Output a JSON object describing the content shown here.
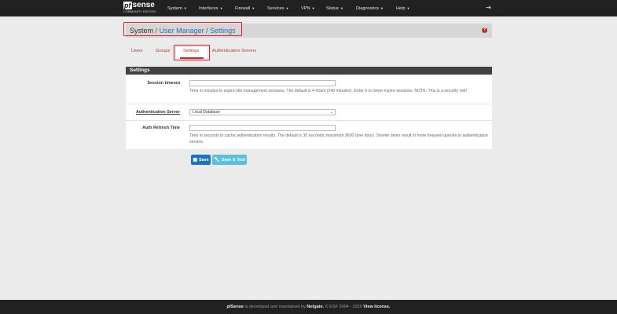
{
  "brand": {
    "name_pf": "pf",
    "name_sense": "sense",
    "edition": "COMMUNITY EDITION"
  },
  "nav": {
    "items": [
      {
        "label": "System"
      },
      {
        "label": "Interfaces"
      },
      {
        "label": "Firewall"
      },
      {
        "label": "Services"
      },
      {
        "label": "VPN"
      },
      {
        "label": "Status"
      },
      {
        "label": "Diagnostics"
      },
      {
        "label": "Help"
      }
    ],
    "logout_icon": "sign-out-icon"
  },
  "breadcrumb": {
    "root": "System",
    "sep": "/",
    "parent": "User Manager",
    "current": "Settings",
    "help_icon": "question-circle-icon"
  },
  "tabs": [
    {
      "label": "Users",
      "active": false
    },
    {
      "label": "Groups",
      "active": false
    },
    {
      "label": "Settings",
      "active": true
    },
    {
      "label": "Authentication Servers",
      "active": false
    }
  ],
  "panel": {
    "title": "Settings",
    "session_timeout": {
      "label": "Session timeout",
      "value": "",
      "help": "Time in minutes to expire idle management sessions. The default is 4 hours (240 minutes). Enter 0 to never expire sessions. NOTE: This is a security risk!"
    },
    "auth_server": {
      "label": "Authentication Server",
      "selected": "Local Database"
    },
    "auth_refresh": {
      "label": "Auth Refresh Time",
      "value": "",
      "help": "Time in seconds to cache authentication results. The default is 30 seconds, maximum 3600 (one hour). Shorter times result in more frequent queries to authentication servers."
    }
  },
  "buttons": {
    "save": "Save",
    "save_test": "Save & Test"
  },
  "footer": {
    "brand": "pfSense",
    "text1": " is developed and maintained by ",
    "company": "Netgate.",
    "text2": " © ESF 2004 - 2020 ",
    "license": "View license."
  },
  "colors": {
    "accent": "#e0202a",
    "link": "#2a72b5",
    "navbar": "#212121",
    "save_button": "#1e73be",
    "test_button": "#5bc0de"
  }
}
